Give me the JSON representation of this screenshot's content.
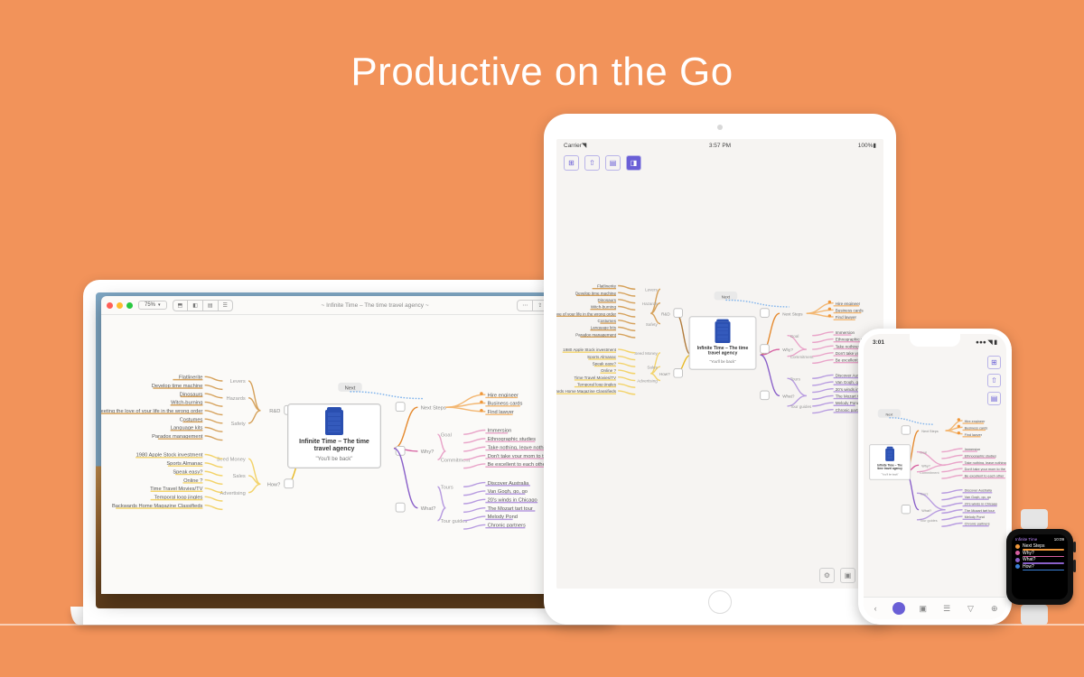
{
  "headline": "Productive on the Go",
  "doc": {
    "title": "Infinite Time – The time travel agency",
    "subtitle": "\"You'll be back\"",
    "zoom": "75%",
    "next_tag": "Next"
  },
  "mac": {
    "win_title": "~ Infinite Time – The time travel agency ~"
  },
  "ipad": {
    "carrier": "Carrier",
    "time": "3:57 PM",
    "battery": "100%"
  },
  "iphone": {
    "time": "3:01"
  },
  "watch": {
    "title": "Infinite Time",
    "time": "10:09",
    "rows": [
      {
        "label": "Next Steps",
        "color": "#f0973a"
      },
      {
        "label": "Why?",
        "color": "#d65fa0"
      },
      {
        "label": "What?",
        "color": "#8a60c9"
      },
      {
        "label": "How?",
        "color": "#3a7fd6"
      }
    ]
  },
  "left_branches": [
    {
      "tag": "R&D",
      "color": "brown",
      "items": [
        {
          "sub": "Levers",
          "leaves": [
            "Flatlinerite",
            "Develop time machine"
          ]
        },
        {
          "sub": "Hazards",
          "leaves": [
            "Dinosaurs",
            "Witch-burning",
            "Meeting the love of your life in the wrong order"
          ]
        },
        {
          "sub": "Safety",
          "leaves": [
            "Costumes",
            "Language kits",
            "Paradox management"
          ]
        }
      ]
    },
    {
      "tag": "How?",
      "color": "yellow",
      "items": [
        {
          "sub": "Seed Money",
          "leaves": [
            "1980 Apple Stock investment",
            "Sports Almanac"
          ]
        },
        {
          "sub": "Sales",
          "leaves": [
            "Speak easy?",
            "Online ?"
          ]
        },
        {
          "sub": "Advertising",
          "leaves": [
            "Time Travel Movies/TV",
            "Temporal loop jingles",
            "Backwards Home Magazine Classifieds"
          ]
        }
      ]
    }
  ],
  "right_branches": [
    {
      "tag": "Next Steps",
      "color": "orange",
      "bullet": true,
      "items": [
        {
          "leaves": [
            "Hire engineer",
            "Business cards",
            "Find lawyer"
          ]
        }
      ]
    },
    {
      "tag": "Why?",
      "color": "pink",
      "items": [
        {
          "sub": "Goal",
          "leaves": [
            "Immersion",
            "Ethnographic studies",
            "Take nothing, leave nothing except the whale"
          ]
        },
        {
          "sub": "Commitment",
          "leaves": [
            "Don't take your mom to the prom",
            "Be excellent to each other"
          ]
        }
      ]
    },
    {
      "tag": "What?",
      "color": "purple",
      "items": [
        {
          "sub": "Tours",
          "leaves": [
            "Discover Australia",
            "Van Gogh, go, go",
            "20's winds in Chicago",
            "The Mozart tart tour"
          ]
        },
        {
          "sub": "Tour guides",
          "leaves": [
            "Melody Pond",
            "Chronic partners"
          ]
        }
      ]
    }
  ]
}
